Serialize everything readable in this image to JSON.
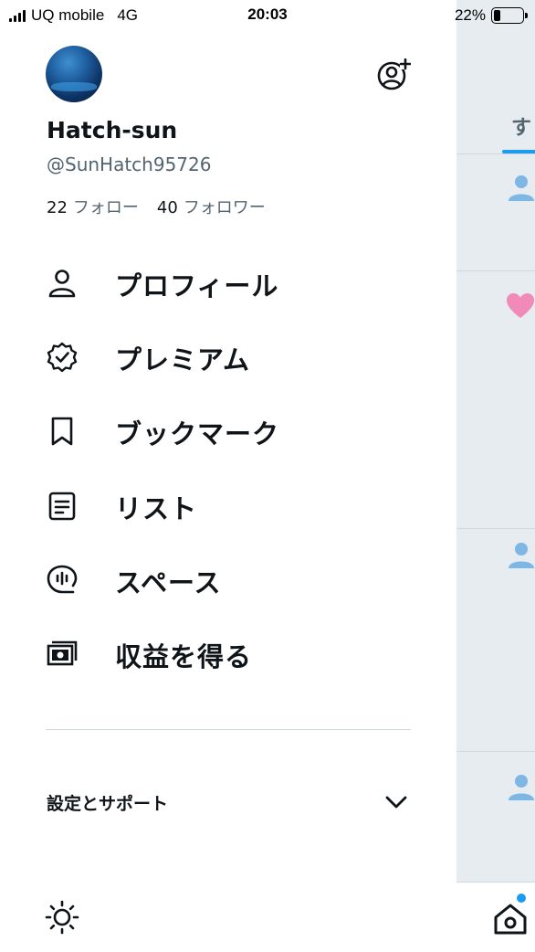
{
  "status_bar": {
    "carrier": "UQ mobile",
    "network": "4G",
    "time": "20:03",
    "battery_percent": "22%"
  },
  "background_feed": {
    "tab_label_partial": "す"
  },
  "profile": {
    "display_name": "Hatch-sun",
    "handle": "@SunHatch95726",
    "following_count": "22",
    "following_label": "フォロー",
    "followers_count": "40",
    "followers_label": "フォロワー"
  },
  "menu": {
    "items": [
      {
        "label": "プロフィール",
        "icon": "person-icon"
      },
      {
        "label": "プレミアム",
        "icon": "verified-badge-icon"
      },
      {
        "label": "ブックマーク",
        "icon": "bookmark-icon"
      },
      {
        "label": "リスト",
        "icon": "list-icon"
      },
      {
        "label": "スペース",
        "icon": "spaces-mic-icon"
      },
      {
        "label": "収益を得る",
        "icon": "money-icon"
      }
    ]
  },
  "settings": {
    "label": "設定とサポート"
  },
  "colors": {
    "text_primary": "#0f1419",
    "text_secondary": "#536471",
    "accent_blue": "#1d9bf0",
    "divider": "#cfd9de",
    "like_pink": "#f18ab8"
  }
}
